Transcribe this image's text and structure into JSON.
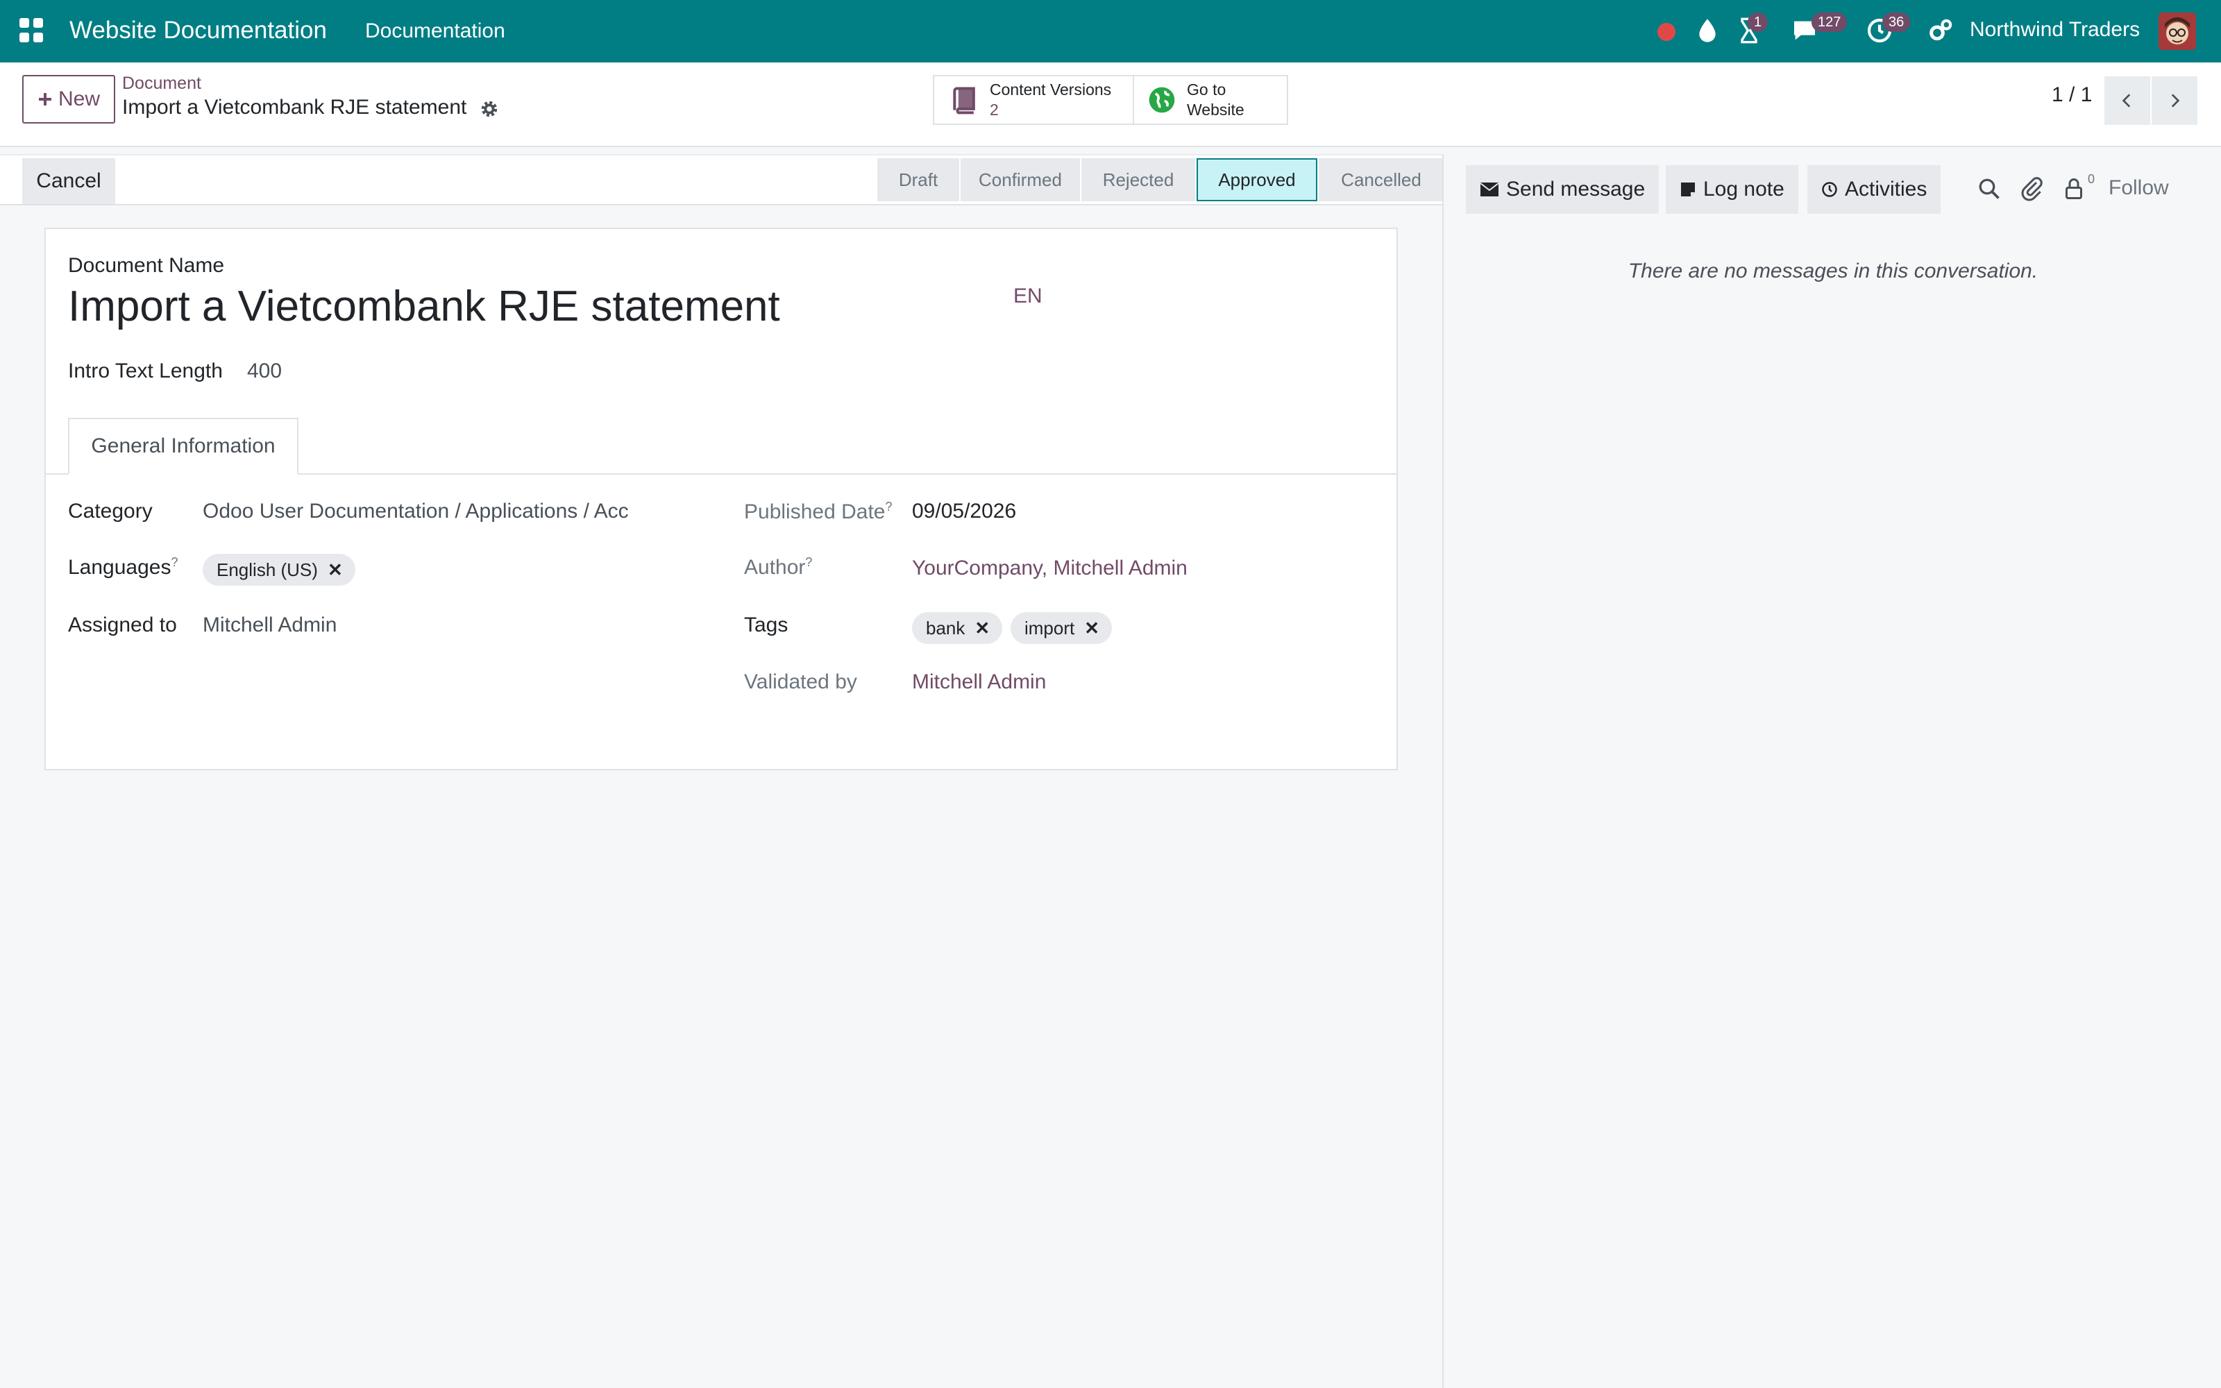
{
  "navbar": {
    "app_title": "Website Documentation",
    "menu_item": "Documentation",
    "badges": {
      "activities": "1",
      "messages": "127",
      "clock": "36"
    },
    "company": "Northwind Traders"
  },
  "control": {
    "new_label": "New",
    "breadcrumb_parent": "Document",
    "breadcrumb_current": "Import a Vietcombank RJE statement",
    "smart_buttons": {
      "content_versions_label": "Content Versions",
      "content_versions_count": "2",
      "go_to_line1": "Go to",
      "go_to_line2": "Website"
    },
    "pager": "1 / 1"
  },
  "statusbar": {
    "cancel_label": "Cancel",
    "stages": [
      "Draft",
      "Confirmed",
      "Rejected",
      "Approved",
      "Cancelled"
    ],
    "active_stage": "Approved"
  },
  "form": {
    "doc_name_label": "Document Name",
    "doc_name": "Import a Vietcombank RJE statement",
    "lang_code": "EN",
    "intro_label": "Intro Text Length",
    "intro_value": "400",
    "tab_label": "General Information",
    "category_label": "Category",
    "category_value": "Odoo User Documentation / Applications / Acc",
    "languages_label": "Languages",
    "languages_tags": [
      "English (US)"
    ],
    "assigned_label": "Assigned to",
    "assigned_value": "Mitchell Admin",
    "published_label": "Published Date",
    "published_value": "09/05/2026",
    "author_label": "Author",
    "author_value": "YourCompany, Mitchell Admin",
    "tags_label": "Tags",
    "tags": [
      "bank",
      "import"
    ],
    "validated_label": "Validated by",
    "validated_value": "Mitchell Admin",
    "help_mark": "?"
  },
  "chatter": {
    "send_message": "Send message",
    "log_note": "Log note",
    "activities": "Activities",
    "follower_count": "0",
    "follow": "Follow",
    "empty_text": "There are no messages in this conversation."
  },
  "colors": {
    "navbar": "#017e84",
    "brand": "#714b67",
    "active_stage": "#c8f3f6"
  }
}
